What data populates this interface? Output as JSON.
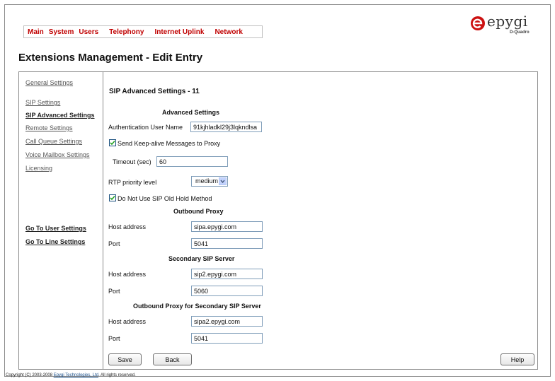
{
  "topnav": {
    "items": [
      "Main",
      "System",
      "Users",
      "Telephony",
      "Internet Uplink",
      "Network"
    ]
  },
  "logo": {
    "text": "epygi",
    "sub": "D-Quadro"
  },
  "page": {
    "title": "Extensions Management - Edit Entry"
  },
  "sidebar": {
    "items": [
      {
        "label": "General Settings"
      },
      {
        "label": "SIP Settings"
      },
      {
        "label": "SIP Advanced Settings"
      },
      {
        "label": "Remote Settings"
      },
      {
        "label": "Call Queue Settings"
      },
      {
        "label": "Voice Mailbox Settings"
      },
      {
        "label": "Licensing"
      }
    ],
    "links": [
      {
        "label": "Go To User Settings"
      },
      {
        "label": "Go To Line Settings"
      }
    ]
  },
  "main": {
    "section_title": "SIP Advanced Settings - 11",
    "advanced": {
      "header": "Advanced Settings",
      "auth_label": "Authentication User Name",
      "auth_value": "91kjhladkl29j3lqkndlsa",
      "keepalive_label": "Send Keep-alive Messages to Proxy",
      "keepalive_checked": true,
      "timeout_label": "Timeout (sec)",
      "timeout_value": "60",
      "rtp_label": "RTP priority level",
      "rtp_value": "medium",
      "oldhold_label": "Do Not Use SIP Old Hold Method",
      "oldhold_checked": true
    },
    "outbound": {
      "header": "Outbound Proxy",
      "host_label": "Host address",
      "host_value": "sipa.epygi.com",
      "port_label": "Port",
      "port_value": "5041"
    },
    "secondary": {
      "header": "Secondary SIP Server",
      "host_label": "Host address",
      "host_value": "sip2.epygi.com",
      "port_label": "Port",
      "port_value": "5060"
    },
    "outbound_secondary": {
      "header": "Outbound Proxy for Secondary SIP Server",
      "host_label": "Host address",
      "host_value": "sipa2.epygi.com",
      "port_label": "Port",
      "port_value": "5041"
    }
  },
  "buttons": {
    "save": "Save",
    "back": "Back",
    "help": "Help"
  },
  "footer": {
    "prefix": "Copyright (C) 2003-2008 ",
    "link": "Epygi Technologies, Ltd",
    "suffix": ". All rights reserved."
  },
  "colors": {
    "nav_red": "#c00000",
    "logo_red": "#cc1111",
    "border": "#8c8c8c",
    "input_border": "#7f9db9"
  }
}
